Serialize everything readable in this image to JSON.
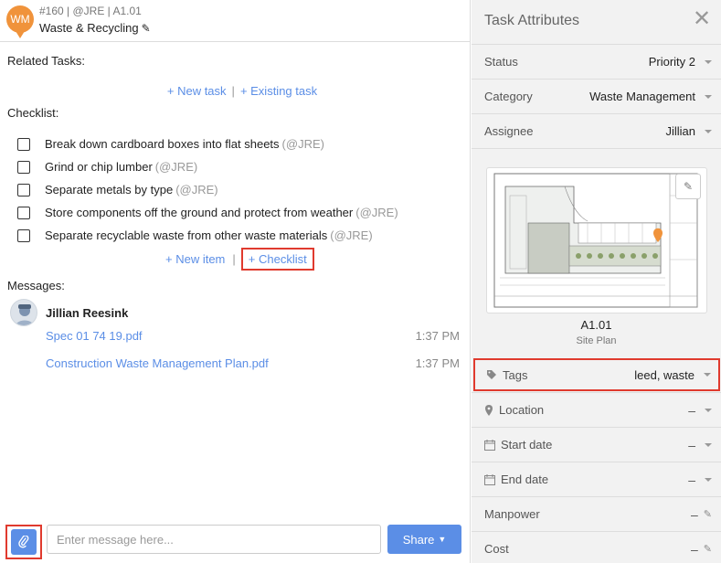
{
  "task": {
    "avatar_initials": "WM",
    "meta": "#160 | @JRE | A1.01",
    "title": "Waste & Recycling"
  },
  "related_tasks": {
    "label": "Related Tasks:",
    "new_task": "+ New task",
    "existing_task": "+ Existing task",
    "separator": "|"
  },
  "checklist": {
    "label": "Checklist:",
    "items": [
      {
        "text": "Break down cardboard boxes into flat sheets",
        "mention": "(@JRE)"
      },
      {
        "text": "Grind or chip lumber",
        "mention": "(@JRE)"
      },
      {
        "text": "Separate metals by type",
        "mention": "(@JRE)"
      },
      {
        "text": "Store components off the ground and protect from weather",
        "mention": "(@JRE)"
      },
      {
        "text": "Separate recyclable waste from other waste materials",
        "mention": "(@JRE)"
      }
    ],
    "new_item": "+ New item",
    "add_checklist": "+ Checklist",
    "separator": "|"
  },
  "messages": {
    "label": "Messages:",
    "author": "Jillian Reesink",
    "items": [
      {
        "file": "Spec 01 74 19.pdf",
        "time": "1:37 PM"
      },
      {
        "file": "Construction Waste Management Plan.pdf",
        "time": "1:37 PM"
      }
    ]
  },
  "composer": {
    "placeholder": "Enter message here...",
    "share_label": "Share"
  },
  "attributes": {
    "title": "Task Attributes",
    "status": {
      "label": "Status",
      "value": "Priority 2"
    },
    "category": {
      "label": "Category",
      "value": "Waste Management"
    },
    "assignee": {
      "label": "Assignee",
      "value": "Jillian"
    },
    "sheet": {
      "name": "A1.01",
      "subtitle": "Site Plan"
    },
    "tags": {
      "label": "Tags",
      "value": "leed, waste"
    },
    "location": {
      "label": "Location",
      "value": "–"
    },
    "start_date": {
      "label": "Start date",
      "value": "–"
    },
    "end_date": {
      "label": "End date",
      "value": "–"
    },
    "manpower": {
      "label": "Manpower",
      "value": "–"
    },
    "cost": {
      "label": "Cost",
      "value": "–"
    }
  },
  "colors": {
    "accent": "#5b8ee6",
    "pin": "#f0933b",
    "highlight": "#e03a2e"
  }
}
